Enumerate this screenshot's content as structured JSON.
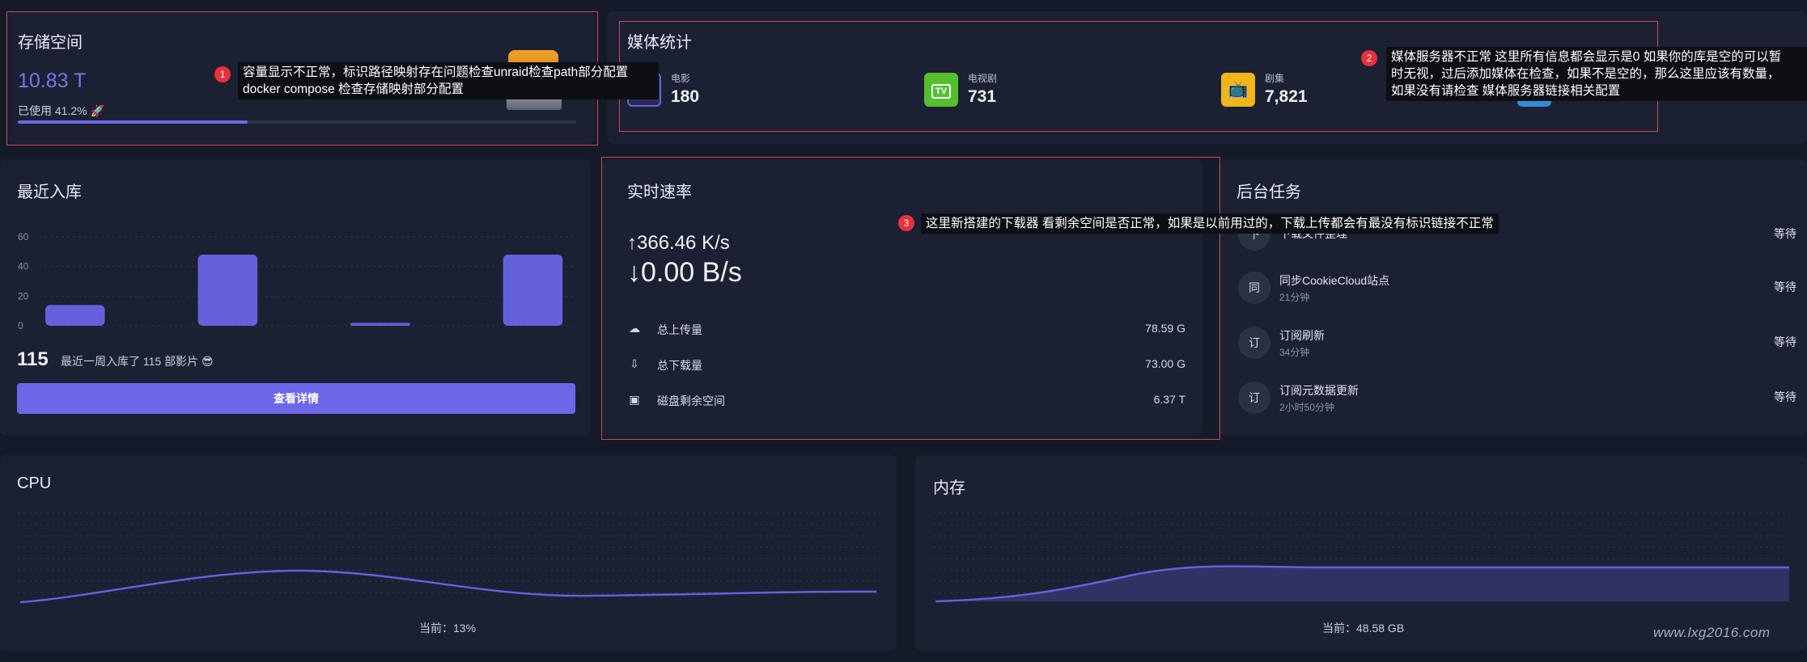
{
  "storage": {
    "title": "存储空间",
    "total": "10.83 T",
    "used_label": "已使用 41.2%",
    "used_emoji": "🚀",
    "used_fraction": 0.412
  },
  "media": {
    "title": "媒体统计",
    "items": [
      {
        "label": "电影",
        "value": "180",
        "icon": "movie-reel-icon",
        "color": "#6a63d8"
      },
      {
        "label": "电视剧",
        "value": "731",
        "icon": "tv-icon",
        "color": "#54c02f"
      },
      {
        "label": "剧集",
        "value": "7,821",
        "icon": "episode-tv-icon",
        "color": "#f1b51a"
      }
    ],
    "tv_icon_text": "TV"
  },
  "recent": {
    "title": "最近入库",
    "count": "115",
    "text": "最近一周入库了 115 部影片 😎",
    "button": "查看详情"
  },
  "chart_data": {
    "type": "bar",
    "categories": [
      "",
      "",
      "",
      "",
      "",
      "",
      ""
    ],
    "values": [
      14,
      0,
      48,
      0,
      2,
      0,
      48
    ],
    "ylim": [
      0,
      60
    ],
    "yticks": [
      "0",
      "20",
      "40",
      "60"
    ],
    "grid": true
  },
  "speed": {
    "title": "实时速率",
    "upload": "↑366.46 K/s",
    "download": "↓0.00 B/s",
    "rows": [
      {
        "label": "总上传量",
        "value": "78.59 G",
        "icon": "cloud-upload-icon"
      },
      {
        "label": "总下载量",
        "value": "73.00 G",
        "icon": "download-box-icon"
      },
      {
        "label": "磁盘剩余空间",
        "value": "6.37 T",
        "icon": "disk-save-icon"
      }
    ]
  },
  "tasks": {
    "title": "后台任务",
    "items": [
      {
        "avatar": "下",
        "name": "下载文件整理",
        "time": "",
        "status": "等待"
      },
      {
        "avatar": "同",
        "name": "同步CookieCloud站点",
        "time": "21分钟",
        "status": "等待"
      },
      {
        "avatar": "订",
        "name": "订阅刷新",
        "time": "34分钟",
        "status": "等待"
      },
      {
        "avatar": "订",
        "name": "订阅元数据更新",
        "time": "2小时50分钟",
        "status": "等待"
      }
    ]
  },
  "cpu": {
    "title": "CPU",
    "current": "当前：13%"
  },
  "memory": {
    "title": "内存",
    "current": "当前：48.58 GB"
  },
  "annotations": [
    {
      "num": "1",
      "text1": "容量显示不正常，标识路径映射存在问题检查unraid检查path部分配置",
      "text2": "docker compose 检查存储映射部分配置"
    },
    {
      "num": "2",
      "text1": "媒体服务器不正常 这里所有信息都会显示是0 如果你的库是空的可以暂",
      "text2": "时无视，过后添加媒体在检查，如果不是空的，那么这里应该有数量，",
      "text3": "如果没有请检查 媒体服务器链接相关配置"
    },
    {
      "num": "3",
      "text1": "这里新搭建的下载器 看剩余空间是否正常，如果是以前用过的，下载上传都会有最没有标识链接不正常"
    }
  ],
  "watermark": "www.lxg2016.com",
  "colors": {
    "accent": "#6c66e8",
    "annotation_red": "#d9434b",
    "background": "#141a28",
    "card": "#1b2133"
  }
}
